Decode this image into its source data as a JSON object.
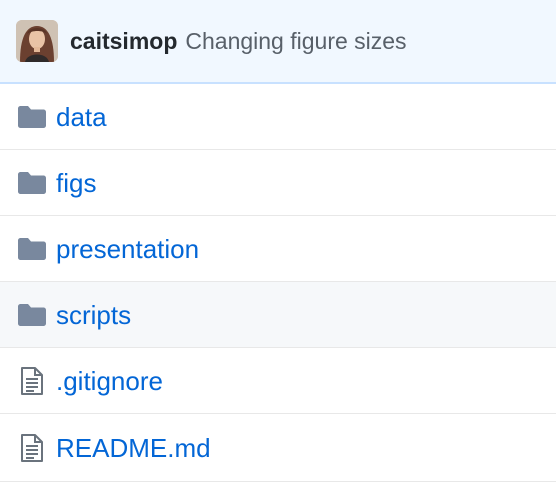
{
  "commit": {
    "author": "caitsimop",
    "message": "Changing figure sizes"
  },
  "colors": {
    "header_bg": "#f1f8ff",
    "header_border": "#c8e1ff",
    "link": "#0366d6",
    "folder_icon": "#79889e",
    "file_icon": "#6a737d"
  },
  "files": [
    {
      "name": "data",
      "type": "folder",
      "icon": "folder-icon"
    },
    {
      "name": "figs",
      "type": "folder",
      "icon": "folder-icon"
    },
    {
      "name": "presentation",
      "type": "folder",
      "icon": "folder-icon"
    },
    {
      "name": "scripts",
      "type": "folder",
      "icon": "folder-icon"
    },
    {
      "name": ".gitignore",
      "type": "file",
      "icon": "file-icon"
    },
    {
      "name": "README.md",
      "type": "file",
      "icon": "file-icon"
    }
  ]
}
